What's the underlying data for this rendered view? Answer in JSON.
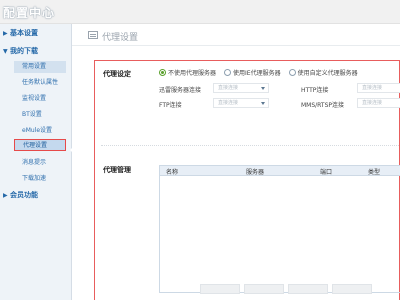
{
  "app": {
    "title": "配置中心"
  },
  "sidebar": {
    "groups": [
      {
        "label": "基本设置"
      },
      {
        "label": "我的下载"
      },
      {
        "label": "会员功能"
      }
    ],
    "items": [
      {
        "label": "常用设置"
      },
      {
        "label": "任务默认属性"
      },
      {
        "label": "监视设置"
      },
      {
        "label": "BT设置"
      },
      {
        "label": "eMule设置"
      },
      {
        "label": "代理设置"
      },
      {
        "label": "消息提示"
      },
      {
        "label": "下载加速"
      }
    ]
  },
  "page": {
    "title": "代理设置"
  },
  "proxy_settings": {
    "section_label": "代理设定",
    "options": [
      {
        "label": "不使用代理服务器",
        "selected": true
      },
      {
        "label": "使用IE代理服务器",
        "selected": false
      },
      {
        "label": "使用自定义代理服务器",
        "selected": false
      }
    ],
    "fields": [
      {
        "label": "迅雷服务器连接",
        "value": "直接连接"
      },
      {
        "label": "HTTP连接",
        "value": "直接连接"
      },
      {
        "label": "FTP连接",
        "value": "直接连接"
      },
      {
        "label": "MMS/RTSP连接",
        "value": "直接连接"
      }
    ]
  },
  "proxy_management": {
    "section_label": "代理管理",
    "columns": [
      "名称",
      "服务器",
      "端口",
      "类型"
    ],
    "rows": []
  },
  "colors": {
    "accent": "#2f6fad",
    "highlight_border": "#e64a4a",
    "radio_on": "#5aa02c"
  }
}
